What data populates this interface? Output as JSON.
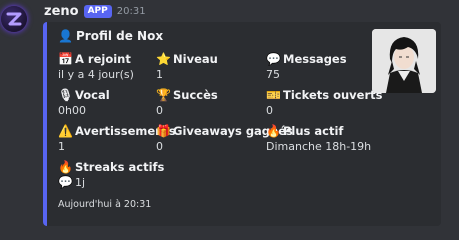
{
  "message": {
    "username": "zeno",
    "badge": "APP",
    "timestamp": "20:31"
  },
  "embed": {
    "accent_color": "#5865f2",
    "title": "Profil de Nox",
    "title_icon": "bust-silhouette-icon",
    "fields": [
      {
        "name": "A rejoint",
        "value": "il y a 4 jour(s)",
        "icon": "calendar-icon"
      },
      {
        "name": "Niveau",
        "value": "1",
        "icon": "star-icon"
      },
      {
        "name": "Messages",
        "value": "75",
        "icon": "speech-balloon-icon"
      },
      {
        "name": "Vocal",
        "value": "0h00",
        "icon": "microphone-icon"
      },
      {
        "name": "Succès",
        "value": "0",
        "icon": "trophy-icon"
      },
      {
        "name": "Tickets ouverts",
        "value": "0",
        "icon": "ticket-icon"
      },
      {
        "name": "Avertissements",
        "value": "1",
        "icon": "warning-icon"
      },
      {
        "name": "Giveaways gagnés",
        "value": "0",
        "icon": "gift-icon"
      },
      {
        "name": "Plus actif",
        "value": "Dimanche 18h-19h",
        "icon": "fire-icon"
      },
      {
        "name": "Streaks actifs",
        "value": "1j",
        "icon": "fire-icon",
        "value_icon": "speech-balloon-icon"
      }
    ],
    "footer": "Aujourd'hui à 20:31"
  }
}
